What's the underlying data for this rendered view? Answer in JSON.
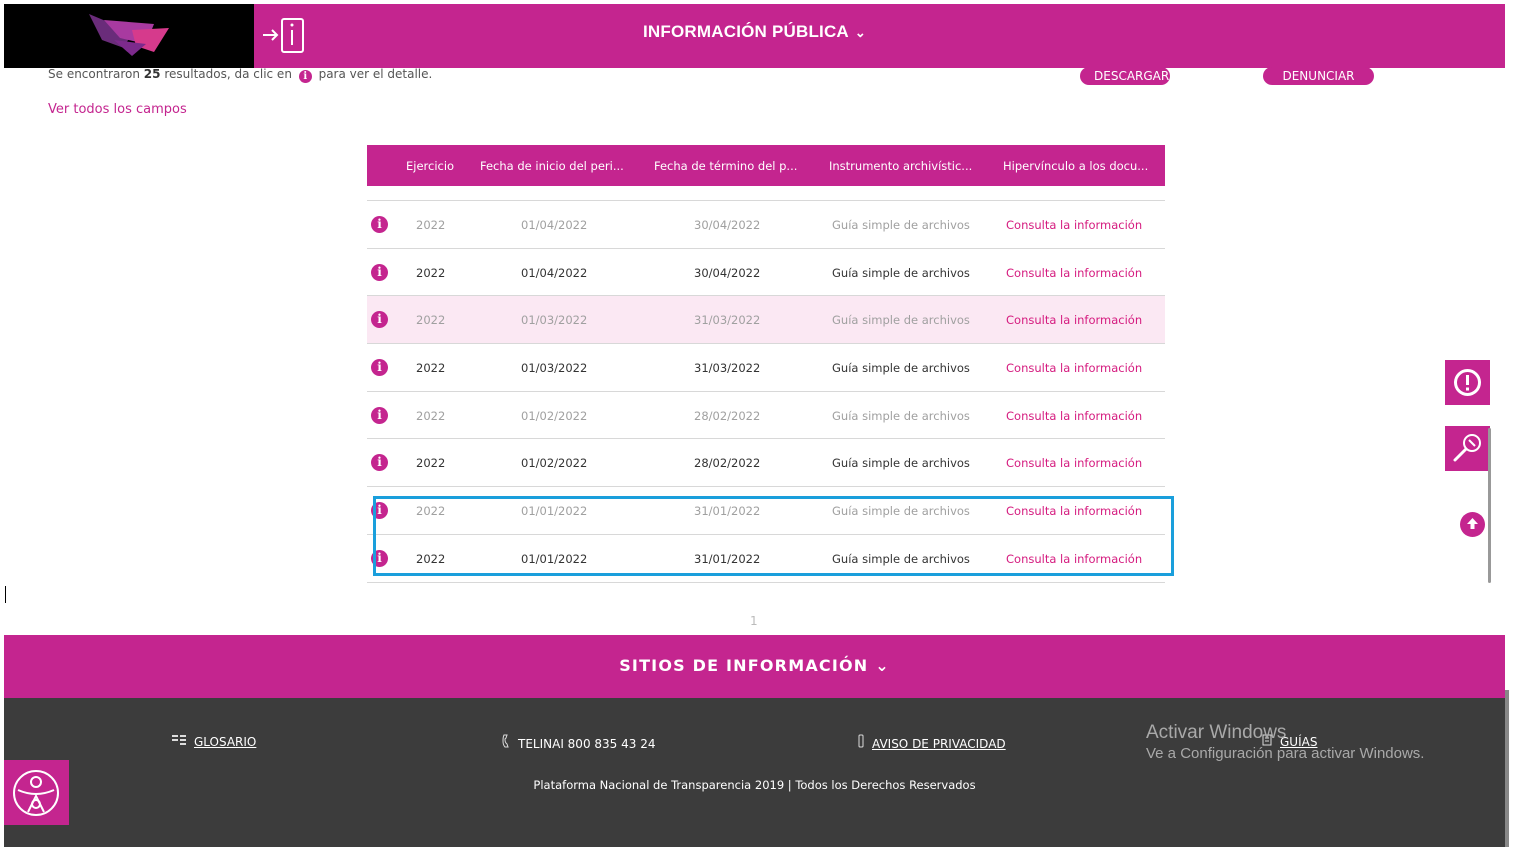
{
  "header": {
    "title": "INFORMACIÓN PÚBLICA",
    "chevron": "⌄",
    "login_icon": "login-arrow-icon"
  },
  "results": {
    "prefix": "Se encontraron",
    "count": "25",
    "middle": "resultados, da clic en",
    "suffix": "para ver el detalle.",
    "info_glyph": "i"
  },
  "actions": {
    "download": "DESCARGAR",
    "report": "DENUNCIAR",
    "view_all": "Ver todos los campos"
  },
  "table": {
    "headers": [
      "Ejercicio",
      "Fecha de inicio del peri...",
      "Fecha de término del p...",
      "Instrumento archivístic...",
      "Hipervínculo a los docu..."
    ],
    "rows": [
      {
        "ejercicio": "2022",
        "inicio": "01/04/2022",
        "termino": "30/04/2022",
        "instrumento": "Guía simple de archivos",
        "link": "Consulta la información"
      },
      {
        "ejercicio": "2022",
        "inicio": "01/04/2022",
        "termino": "30/04/2022",
        "instrumento": "Guía simple de archivos",
        "link": "Consulta la información"
      },
      {
        "ejercicio": "2022",
        "inicio": "01/03/2022",
        "termino": "31/03/2022",
        "instrumento": "Guía simple de archivos",
        "link": "Consulta la información"
      },
      {
        "ejercicio": "2022",
        "inicio": "01/03/2022",
        "termino": "31/03/2022",
        "instrumento": "Guía simple de archivos",
        "link": "Consulta la información"
      },
      {
        "ejercicio": "2022",
        "inicio": "01/02/2022",
        "termino": "28/02/2022",
        "instrumento": "Guía simple de archivos",
        "link": "Consulta la información"
      },
      {
        "ejercicio": "2022",
        "inicio": "01/02/2022",
        "termino": "28/02/2022",
        "instrumento": "Guía simple de archivos",
        "link": "Consulta la información"
      },
      {
        "ejercicio": "2022",
        "inicio": "01/01/2022",
        "termino": "31/01/2022",
        "instrumento": "Guía simple de archivos",
        "link": "Consulta la información"
      },
      {
        "ejercicio": "2022",
        "inicio": "01/01/2022",
        "termino": "31/01/2022",
        "instrumento": "Guía simple de archivos",
        "link": "Consulta la información"
      }
    ],
    "row_icon": "i"
  },
  "pagination": {
    "current": "1"
  },
  "sitios": {
    "label": "SITIOS DE INFORMACIÓN",
    "chevron": "⌄"
  },
  "footer": {
    "glosario": "GLOSARIO",
    "telinai": "TELINAI 800 835 43 24",
    "aviso": "AVISO DE PRIVACIDAD",
    "guias": "GUÍAS",
    "copyright": "Plataforma Nacional de Transparencia 2019 | Todos los Derechos Reservados"
  },
  "windows_watermark": {
    "line1": "Activar Windows",
    "line2": "Ve a Configuración para activar Windows."
  },
  "colors": {
    "brand": "#c4258f",
    "link": "#d51b7f",
    "footer_bg": "#3c3c3c",
    "annotation_box": "#1a9fdc"
  },
  "icons": {
    "side_alert": "exclamation-circle-icon",
    "side_tools": "wrench-icon",
    "scroll_up": "arrow-up-circle-icon",
    "accessibility": "accessibility-icon",
    "glossary": "glossary-icon",
    "phone": "phone-icon",
    "privacy": "privacy-icon",
    "guides": "guides-icon"
  }
}
